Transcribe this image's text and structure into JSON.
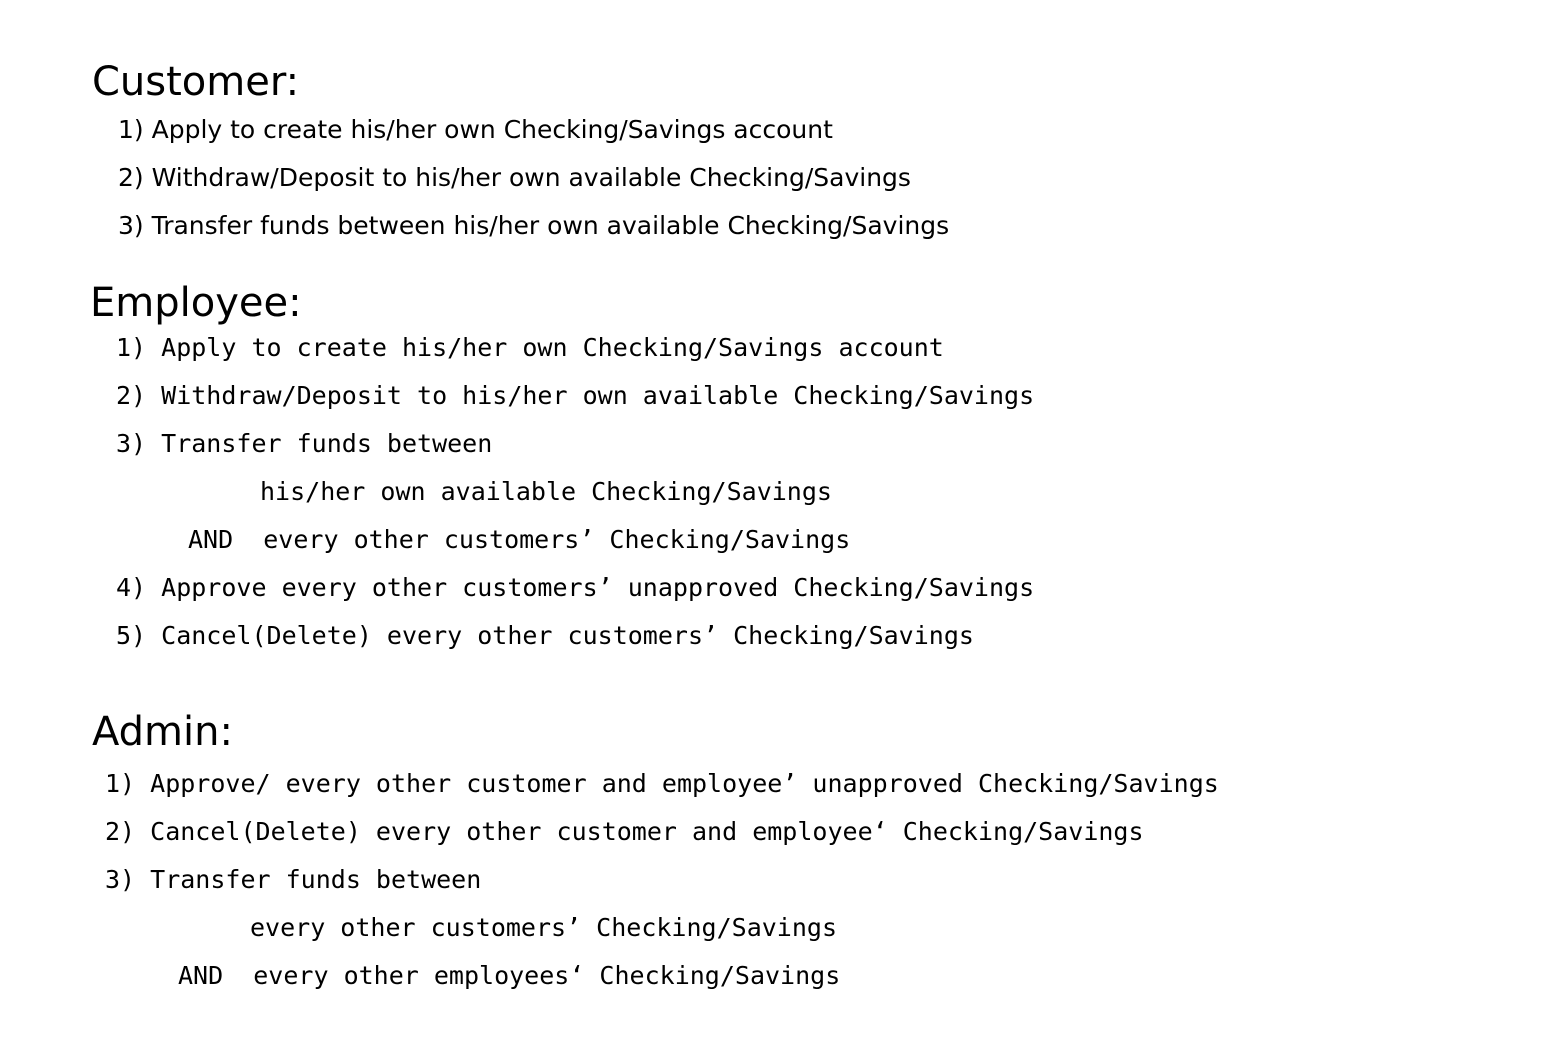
{
  "customer": {
    "title": "Customer:",
    "items": [
      "1) Apply to create his/her own Checking/Savings account",
      "2) Withdraw/Deposit to his/her own available Checking/Savings",
      "3) Transfer funds between his/her own available Checking/Savings"
    ]
  },
  "employee": {
    "title": "Employee:",
    "items": [
      "1) Apply to create his/her own Checking/Savings account",
      "2) Withdraw/Deposit to his/her own available Checking/Savings",
      "3) Transfer funds between",
      "his/her own available Checking/Savings",
      "AND  every other customers’ Checking/Savings",
      "4) Approve every other customers’ unapproved Checking/Savings",
      "5) Cancel(Delete) every other customers’ Checking/Savings"
    ]
  },
  "admin": {
    "title": "Admin:",
    "items": [
      "1) Approve/ every other customer and employee’ unapproved Checking/Savings",
      "2) Cancel(Delete) every other customer and employee‘ Checking/Savings",
      "3) Transfer funds between",
      "every other customers’ Checking/Savings",
      "AND  every other employees‘ Checking/Savings"
    ]
  }
}
